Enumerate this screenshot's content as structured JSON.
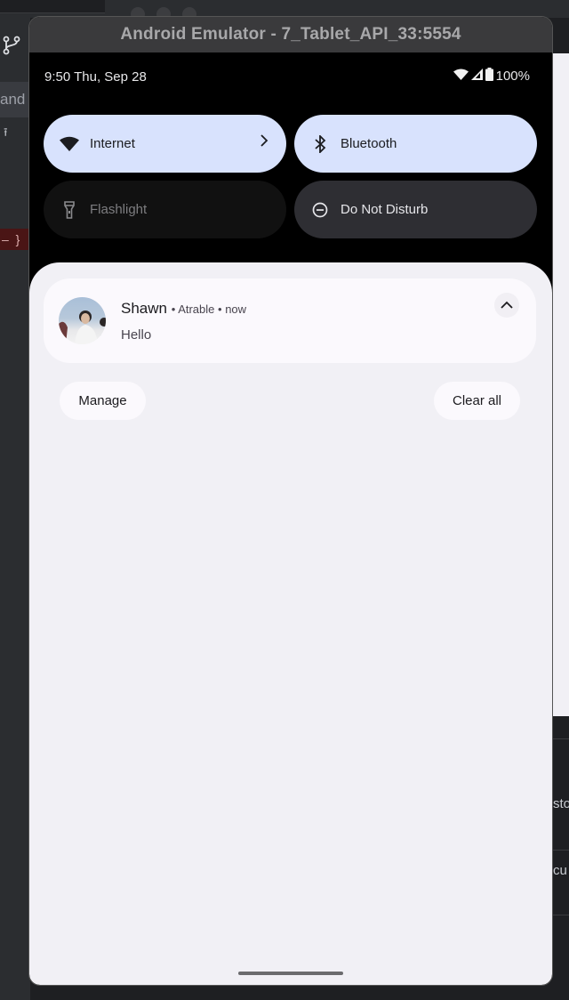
{
  "window": {
    "title": "Android Emulator - 7_Tablet_API_33:5554"
  },
  "status_bar": {
    "datetime": "9:50 Thu, Sep 28",
    "battery": "100%",
    "icons": [
      "wifi-icon",
      "cellular-signal-icon",
      "battery-icon"
    ]
  },
  "quick_settings": [
    {
      "label": "Internet",
      "icon": "wifi-icon",
      "state": "on",
      "has_chevron": true
    },
    {
      "label": "Bluetooth",
      "icon": "bluetooth-icon",
      "state": "on"
    },
    {
      "label": "Flashlight",
      "icon": "flashlight-icon",
      "state": "unavailable"
    },
    {
      "label": "Do Not Disturb",
      "icon": "do-not-disturb-icon",
      "state": "off"
    }
  ],
  "notification": {
    "sender": "Shawn",
    "separator": "•",
    "app": "Atrable",
    "time": "now",
    "message": "Hello",
    "avatar_badge": "ᴧ"
  },
  "actions": {
    "manage": "Manage",
    "clear_all": "Clear all"
  },
  "background_ide": {
    "left_text": "and",
    "right_texts": [
      "sto",
      "cu"
    ]
  }
}
